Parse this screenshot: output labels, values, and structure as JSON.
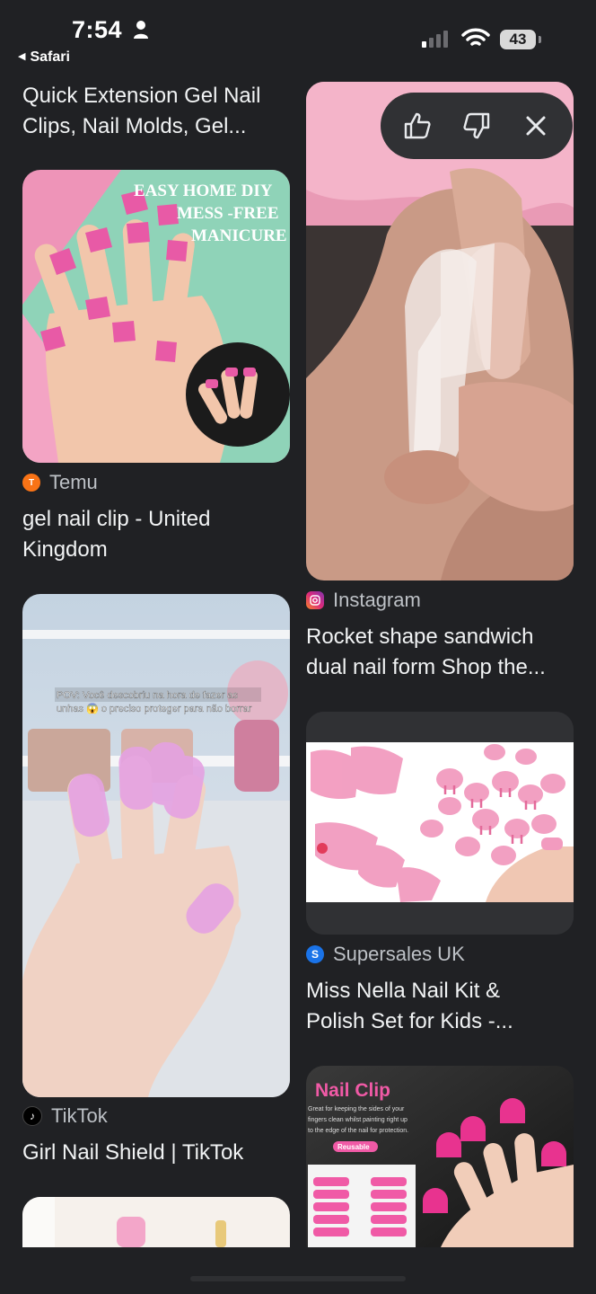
{
  "status_bar": {
    "time": "7:54",
    "back_app": "Safari",
    "battery": "43"
  },
  "feedback": {
    "like": "thumbs-up-icon",
    "dislike": "thumbs-down-icon",
    "close": "close-icon"
  },
  "results": {
    "r0": {
      "title": "Quick Extension Gel Nail Clips, Nail Molds, Gel..."
    },
    "r1": {
      "source": "Temu",
      "title_line1": "gel nail clip - United",
      "title_line2": "Kingdom"
    },
    "r2": {
      "source": "Instagram",
      "title_line1": "Rocket shape sandwich",
      "title_line2": "dual nail form Shop the..."
    },
    "r3": {
      "source": "TikTok",
      "title": "Girl Nail Shield | TikTok"
    },
    "r4": {
      "source": "Supersales UK",
      "title_line1": "Miss Nella Nail Kit &",
      "title_line2": "Polish Set for Kids -..."
    }
  },
  "image_text": {
    "temu_banner_line1": "EASY HOME DIY",
    "temu_banner_line2": "MESS -FREE",
    "temu_banner_line3": "MANICURE",
    "tiktok_caption_line1": "POV: Você descobriu na hora de fazer as",
    "tiktok_caption_line2": "unhas 😱 o preciso proteger para não borrar",
    "nailclip_title": "Nail Clip",
    "nailclip_desc1": "Great for keeping the sides of your",
    "nailclip_desc2": "fingers clean whilst painting right up",
    "nailclip_desc3": "to the edge of the nail for protection.",
    "nailclip_badge": "Reusable"
  },
  "colors": {
    "background": "#202124",
    "temu_icon": "#f97316",
    "supersales_icon": "#1a73e8",
    "pink": "#e85aa6"
  }
}
